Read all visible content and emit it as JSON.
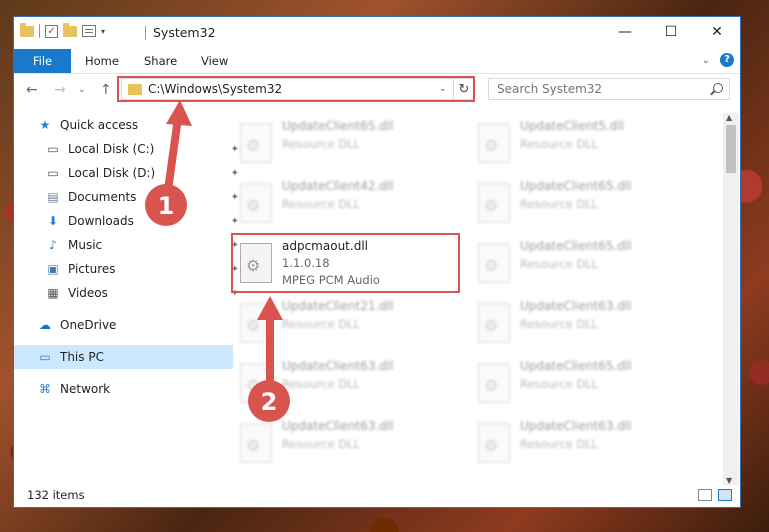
{
  "window": {
    "title": "System32",
    "minimize_glyph": "—",
    "maximize_glyph": "☐",
    "close_glyph": "✕"
  },
  "ribbon": {
    "tabs": [
      "File",
      "Home",
      "Share",
      "View"
    ],
    "collapse_glyph": "⌄",
    "help_glyph": "?"
  },
  "nav": {
    "back_glyph": "←",
    "forward_glyph": "→",
    "recent_glyph": "⌄",
    "up_glyph": "↑",
    "address": "C:\\Windows\\System32",
    "address_dropdown_glyph": "⌄",
    "refresh_glyph": "↻",
    "search_placeholder": "Search System32"
  },
  "sidebar": {
    "items": [
      {
        "label": "Quick access",
        "icon": "star-icon",
        "glyph": "★"
      },
      {
        "label": "Local Disk (C:)",
        "icon": "drive-icon",
        "glyph": "▭",
        "pinned": true
      },
      {
        "label": "Local Disk (D:)",
        "icon": "drive-icon",
        "glyph": "▭",
        "pinned": true
      },
      {
        "label": "Documents",
        "icon": "documents-icon",
        "glyph": "▤",
        "pinned": true
      },
      {
        "label": "Downloads",
        "icon": "download-icon",
        "glyph": "⬇",
        "pinned": true
      },
      {
        "label": "Music",
        "icon": "music-icon",
        "glyph": "♪",
        "pinned": true
      },
      {
        "label": "Pictures",
        "icon": "pictures-icon",
        "glyph": "▣",
        "pinned": true
      },
      {
        "label": "Videos",
        "icon": "videos-icon",
        "glyph": "▦",
        "pinned": true
      },
      {
        "label": "OneDrive",
        "icon": "cloud-icon",
        "glyph": "☁"
      },
      {
        "label": "This PC",
        "icon": "computer-icon",
        "glyph": "▭",
        "selected": true
      },
      {
        "label": "Network",
        "icon": "network-icon",
        "glyph": "⌘"
      }
    ],
    "pin_glyph": "📌"
  },
  "files": {
    "left_column": [
      {
        "name": "UpdateClient65.dll",
        "type": "Resource DLL",
        "blurred": true
      },
      {
        "name": "UpdateClient42.dll",
        "type": "Resource DLL",
        "blurred": true
      },
      {
        "name": "adpcmaout.dll",
        "version": "1.1.0.18",
        "type": "MPEG PCM Audio",
        "blurred": false,
        "highlighted": true
      },
      {
        "name": "UpdateClient21.dll",
        "type": "Resource DLL",
        "blurred": true
      },
      {
        "name": "UpdateClient63.dll",
        "type": "Resource DLL",
        "blurred": true
      },
      {
        "name": "UpdateClient63.dll",
        "type": "Resource DLL",
        "blurred": true
      }
    ],
    "right_column": [
      {
        "name": "UpdateClient5.dll",
        "type": "Resource DLL",
        "blurred": true
      },
      {
        "name": "UpdateClient65.dll",
        "type": "Resource DLL",
        "blurred": true
      },
      {
        "name": "UpdateClient65.dll",
        "type": "Resource DLL",
        "blurred": true
      },
      {
        "name": "UpdateClient63.dll",
        "type": "Resource DLL",
        "blurred": true
      },
      {
        "name": "UpdateClient65.dll",
        "type": "Resource DLL",
        "blurred": true
      },
      {
        "name": "UpdateClient63.dll",
        "type": "Resource DLL",
        "blurred": true
      }
    ]
  },
  "status": {
    "item_count": "132 items"
  },
  "annotations": {
    "step1": "1",
    "step2": "2",
    "color": "#d9534f"
  }
}
